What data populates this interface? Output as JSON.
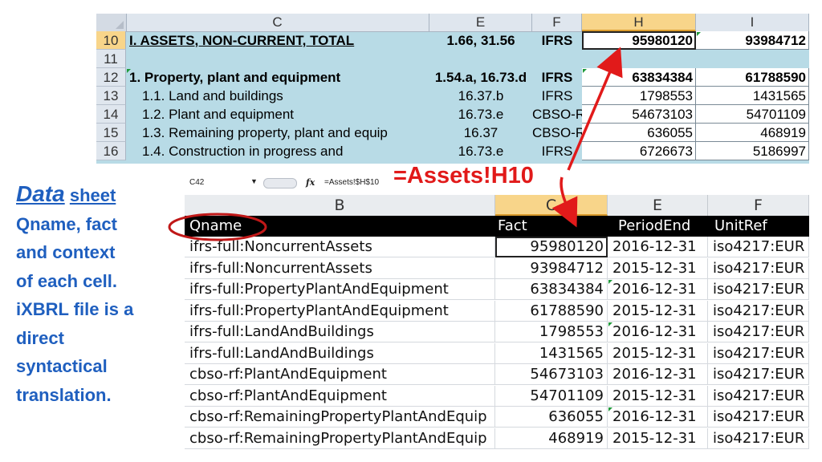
{
  "top_sheet": {
    "col_headers": [
      "C",
      "E",
      "F",
      "H",
      "I"
    ],
    "selected_col": "H",
    "rows": [
      {
        "num": "10",
        "c": "I. ASSETS, NON-CURRENT, TOTAL",
        "e": "1.66, 31.56",
        "f": "IFRS",
        "h": "95980120",
        "i": "93984712"
      },
      {
        "num": "11",
        "c": "",
        "e": "",
        "f": "",
        "h": "",
        "i": ""
      },
      {
        "num": "12",
        "c": "1. Property, plant and equipment",
        "e": "1.54.a, 16.73.d",
        "f": "IFRS",
        "h": "63834384",
        "i": "61788590"
      },
      {
        "num": "13",
        "c": "1.1. Land and buildings",
        "e": "16.37.b",
        "f": "IFRS",
        "h": "1798553",
        "i": "1431565"
      },
      {
        "num": "14",
        "c": "1.2. Plant and equipment",
        "e": "16.73.e",
        "f": "CBSO-RF",
        "h": "54673103",
        "i": "54701109"
      },
      {
        "num": "15",
        "c": "1.3. Remaining property, plant and equip",
        "e": "16.37",
        "f": "CBSO-RF",
        "h": "636055",
        "i": "468919"
      },
      {
        "num": "16",
        "c": "1.4. Construction in progress and",
        "e": "16.73.e",
        "f": "IFRS",
        "h": "6726673",
        "i": "5186997"
      }
    ]
  },
  "formula_bar": {
    "name_box": "C42",
    "fx": "fx",
    "formula": "=Assets!$H$10"
  },
  "callout_formula": "=Assets!H10",
  "data_sheet": {
    "col_headers": [
      "B",
      "C",
      "E",
      "F"
    ],
    "selected_col": "C",
    "headers": [
      "Qname",
      "Fact",
      "PeriodEnd",
      "UnitRef"
    ],
    "rows": [
      {
        "qname": "ifrs-full:NoncurrentAssets",
        "fact": "95980120",
        "period": "2016-12-31",
        "unit": "iso4217:EUR"
      },
      {
        "qname": "ifrs-full:NoncurrentAssets",
        "fact": "93984712",
        "period": "2015-12-31",
        "unit": "iso4217:EUR"
      },
      {
        "qname": "ifrs-full:PropertyPlantAndEquipment",
        "fact": "63834384",
        "period": "2016-12-31",
        "unit": "iso4217:EUR"
      },
      {
        "qname": "ifrs-full:PropertyPlantAndEquipment",
        "fact": "61788590",
        "period": "2015-12-31",
        "unit": "iso4217:EUR"
      },
      {
        "qname": "ifrs-full:LandAndBuildings",
        "fact": "1798553",
        "period": "2016-12-31",
        "unit": "iso4217:EUR"
      },
      {
        "qname": "ifrs-full:LandAndBuildings",
        "fact": "1431565",
        "period": "2015-12-31",
        "unit": "iso4217:EUR"
      },
      {
        "qname": "cbso-rf:PlantAndEquipment",
        "fact": "54673103",
        "period": "2016-12-31",
        "unit": "iso4217:EUR"
      },
      {
        "qname": "cbso-rf:PlantAndEquipment",
        "fact": "54701109",
        "period": "2015-12-31",
        "unit": "iso4217:EUR"
      },
      {
        "qname": "cbso-rf:RemainingPropertyPlantAndEquip",
        "fact": "636055",
        "period": "2016-12-31",
        "unit": "iso4217:EUR"
      },
      {
        "qname": "cbso-rf:RemainingPropertyPlantAndEquip",
        "fact": "468919",
        "period": "2015-12-31",
        "unit": "iso4217:EUR"
      }
    ]
  },
  "annotation": {
    "title_word": "Data",
    "title_rest": "sheet",
    "lines": [
      "Qname, fact",
      "and context",
      "of each cell.",
      "iXBRL file is a",
      "direct",
      "syntactical",
      "translation."
    ]
  },
  "colors": {
    "arrow": "#e11a1a",
    "text_blue": "#1f5fbf",
    "sheet_bg": "#b8dbe6"
  }
}
